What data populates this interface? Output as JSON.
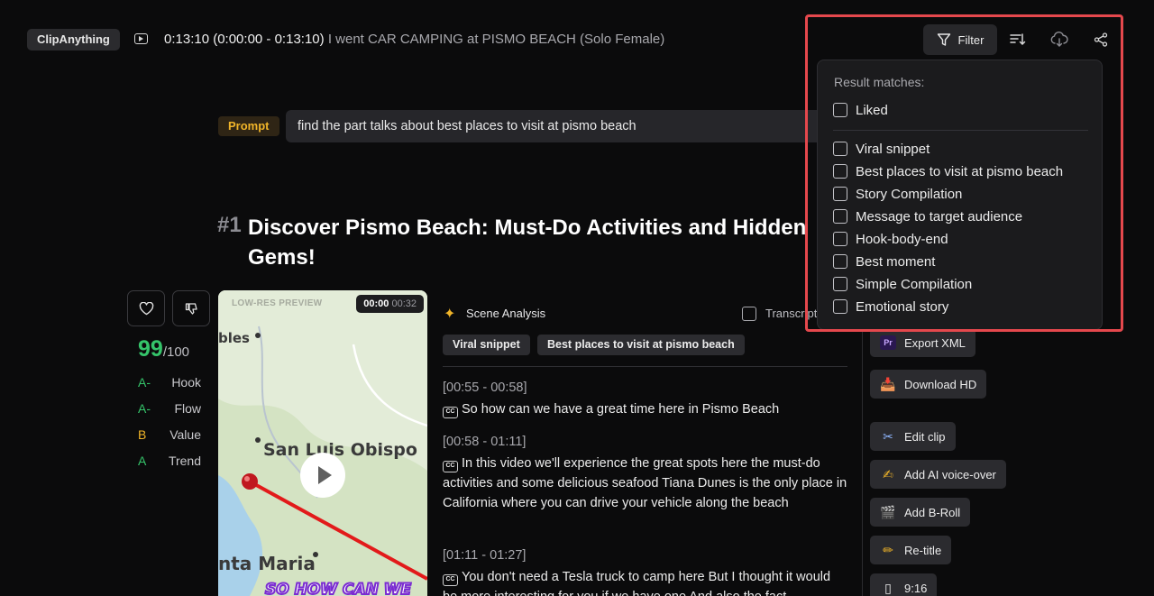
{
  "app": {
    "name": "ClipAnything"
  },
  "video": {
    "time_range": "0:13:10 (0:00:00 - 0:13:10)",
    "title": "I went CAR CAMPING at PISMO BEACH (Solo Female)"
  },
  "toolbar": {
    "filter_label": "Filter",
    "sort_icon": "sort-icon",
    "download_icon": "cloud-download-icon",
    "share_icon": "share-icon"
  },
  "prompt": {
    "tag": "Prompt",
    "text": "find the part talks about best places to visit at pismo beach"
  },
  "clip": {
    "number": "#1",
    "title": "Discover Pismo Beach: Must-Do Activities and Hidden Gems!",
    "score": "99",
    "score_max": "/100",
    "metrics": [
      {
        "grade": "A-",
        "name": "Hook"
      },
      {
        "grade": "A-",
        "name": "Flow"
      },
      {
        "grade": "B",
        "name": "Value"
      },
      {
        "grade": "A",
        "name": "Trend"
      }
    ],
    "preview": {
      "tag": "LOW-RES PREVIEW",
      "current": "00:00",
      "duration": "00:32",
      "map_labels": [
        "bles",
        "San Luis Obispo",
        "nta Maria",
        "SO HOW CAN WE"
      ]
    },
    "scene_analysis_label": "Scene Analysis",
    "transcript_label": "Transcript",
    "chips": [
      "Viral snippet",
      "Best places to visit at pismo beach"
    ],
    "transcript": [
      {
        "ts": "[00:55 - 00:58]",
        "text": "So how can we have a great time here in Pismo Beach"
      },
      {
        "ts": "[00:58 - 01:11]",
        "text": "In this video we'll experience the great spots here the must-do activities and some delicious seafood Tiana Dunes is the only place in California where you can drive your vehicle along the beach"
      },
      {
        "ts": "[01:11 - 01:27]",
        "text": "You don't need a Tesla truck to camp here But I thought it would be more interesting for you if we have one And also the fact"
      }
    ],
    "cc_label": "CC"
  },
  "actions": [
    {
      "label": "Export XML",
      "icon": "premiere-icon"
    },
    {
      "label": "Download HD",
      "icon": "download-tray-icon"
    },
    {
      "label": "Edit clip",
      "icon": "scissors-icon"
    },
    {
      "label": "Add AI voice-over",
      "icon": "voice-icon"
    },
    {
      "label": "Add B-Roll",
      "icon": "clapper-icon"
    },
    {
      "label": "Re-title",
      "icon": "pencil-icon"
    },
    {
      "label": "9:16",
      "icon": "phone-icon"
    }
  ],
  "filter_dropdown": {
    "title": "Result matches:",
    "liked": "Liked",
    "options": [
      "Viral snippet",
      "Best places to visit at pismo beach",
      "Story Compilation",
      "Message to target audience",
      "Hook-body-end",
      "Best moment",
      "Simple Compilation",
      "Emotional story"
    ]
  },
  "colors": {
    "accent_green": "#35c46a",
    "accent_yellow": "#f0b429",
    "highlight_red": "#e5484d",
    "background": "#0b0b0c"
  }
}
